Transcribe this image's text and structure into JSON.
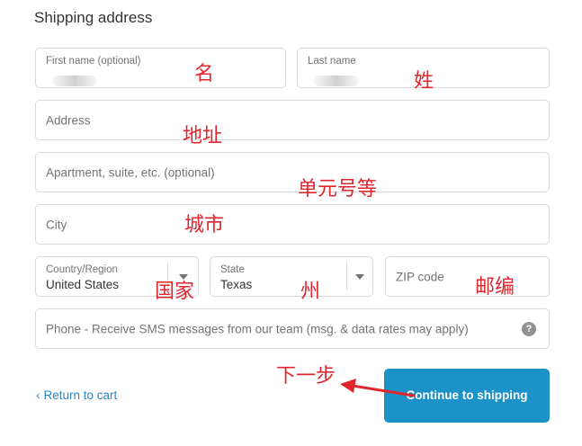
{
  "heading": "Shipping address",
  "fields": {
    "first_name": {
      "label": "First name (optional)"
    },
    "last_name": {
      "label": "Last name"
    },
    "address": {
      "placeholder": "Address"
    },
    "apartment": {
      "placeholder": "Apartment, suite, etc. (optional)"
    },
    "city": {
      "placeholder": "City"
    },
    "country": {
      "label": "Country/Region",
      "value": "United States"
    },
    "state": {
      "label": "State",
      "value": "Texas"
    },
    "zip": {
      "placeholder": "ZIP code"
    },
    "phone": {
      "placeholder": "Phone - Receive SMS messages from our team (msg. & data rates may apply)",
      "help_glyph": "?"
    }
  },
  "annotations": {
    "first_name": "名",
    "last_name": "姓",
    "address": "地址",
    "apartment": "单元号等",
    "city": "城市",
    "country": "国家",
    "state": "州",
    "zip": "邮编",
    "next_step": "下一步"
  },
  "footer": {
    "back_link": "Return to cart",
    "back_chevron": "‹",
    "continue_button": "Continue to shipping"
  },
  "colors": {
    "accent": "#1d92c8",
    "link": "#2a86c5",
    "annotation": "#e0272f"
  }
}
